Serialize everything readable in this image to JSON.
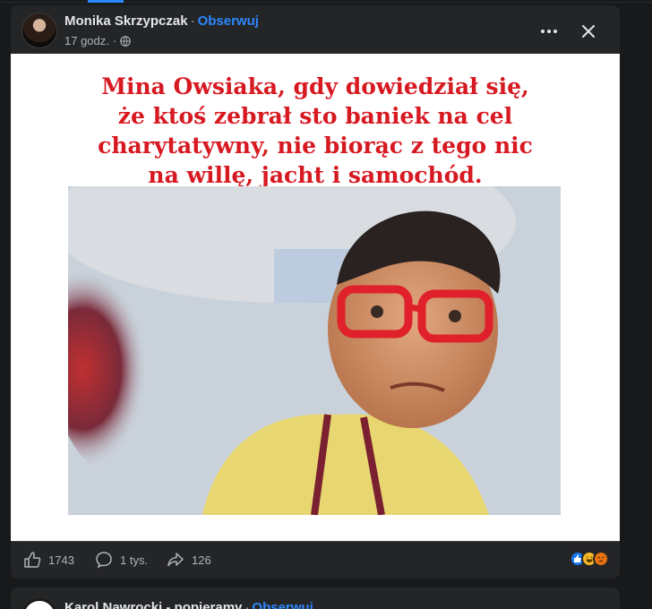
{
  "post": {
    "author": "Monika Skrzypczak",
    "separator": "·",
    "follow_label": "Obserwuj",
    "time": "17 godz.",
    "time_separator": "·",
    "privacy_icon": "globe-icon",
    "more_icon": "more-options-icon",
    "close_icon": "close-icon",
    "image": {
      "caption_lines": [
        "Mina Owsiaka, gdy dowiedział się,",
        "że ktoś zebrał sto baniek na cel",
        "charytatywny, nie biorąc z tego nic",
        "na willę, jacht i samochód."
      ]
    },
    "stats": {
      "likes": "1743",
      "comments": "1 tys.",
      "shares": "126"
    },
    "reaction_icons": [
      "like-reaction-icon",
      "haha-reaction-icon",
      "angry-reaction-icon"
    ]
  },
  "next_post": {
    "author": "Karol Nawrocki - popieramy",
    "separator": "·",
    "follow_label": "Obserwuj"
  },
  "colors": {
    "background": "#18191a",
    "card": "#242526",
    "accent": "#2d88ff",
    "caption_red": "#d71921"
  }
}
